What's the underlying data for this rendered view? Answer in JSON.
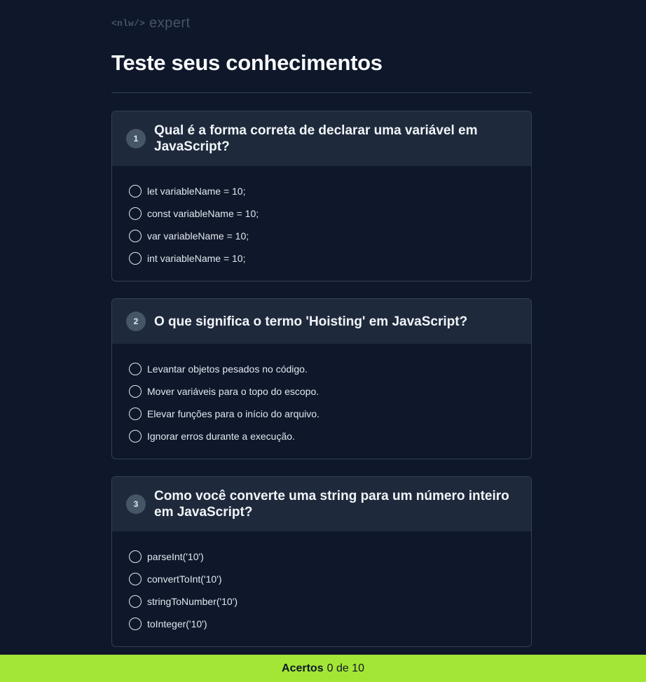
{
  "brand": {
    "nlw": "<nlw/>",
    "expert": "expert"
  },
  "page_title": "Teste seus conhecimentos",
  "questions": [
    {
      "number": "1",
      "title": "Qual é a forma correta de declarar uma variável em JavaScript?",
      "answers": [
        "let variableName = 10;",
        "const variableName = 10;",
        "var variableName = 10;",
        "int variableName = 10;"
      ]
    },
    {
      "number": "2",
      "title": "O que significa o termo 'Hoisting' em JavaScript?",
      "answers": [
        "Levantar objetos pesados no código.",
        "Mover variáveis para o topo do escopo.",
        "Elevar funções para o início do arquivo.",
        "Ignorar erros durante a execução."
      ]
    },
    {
      "number": "3",
      "title": "Como você converte uma string para um número inteiro em JavaScript?",
      "answers": [
        "parseInt('10')",
        "convertToInt('10')",
        "stringToNumber('10')",
        "toInteger('10')"
      ]
    }
  ],
  "footer": {
    "label": "Acertos",
    "score": "0 de 10"
  },
  "colors": {
    "background": "#0f172a",
    "card_header": "#1e293b",
    "accent": "#a3e635"
  }
}
